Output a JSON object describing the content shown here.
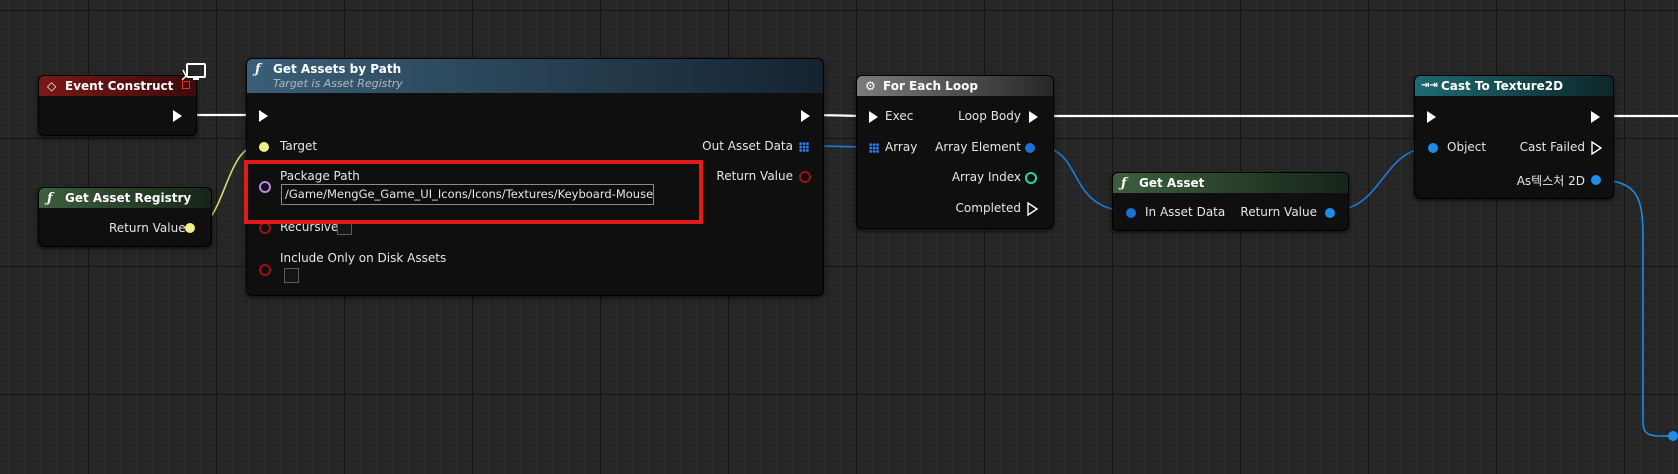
{
  "nodes": {
    "event_construct": {
      "title": "Event Construct"
    },
    "get_asset_registry": {
      "title": "Get Asset Registry",
      "return_value": "Return Value"
    },
    "get_assets_by_path": {
      "title": "Get Assets by Path",
      "subtitle": "Target is Asset Registry",
      "target": "Target",
      "package_path": "Package Path",
      "package_path_value": "/Game/MengGe_Game_UI_Icons/Icons/Textures/Keyboard-Mouse_",
      "recursive": "Recursive",
      "include_only_on_disk": "Include Only on Disk Assets",
      "out_asset_data": "Out Asset Data",
      "return_value": "Return Value"
    },
    "for_each_loop": {
      "title": "For Each Loop",
      "exec": "Exec",
      "array": "Array",
      "loop_body": "Loop Body",
      "array_element": "Array Element",
      "array_index": "Array Index",
      "completed": "Completed"
    },
    "get_asset": {
      "title": "Get Asset",
      "in_asset_data": "In Asset Data",
      "return_value": "Return Value"
    },
    "cast_to_texture2d": {
      "title": "Cast To Texture2D",
      "object": "Object",
      "cast_failed": "Cast Failed",
      "as_texture2d": "As텍스처 2D"
    }
  },
  "colors": {
    "exec_wire": "#ffffff",
    "object_wire": "#0d6fd1",
    "registry_wire": "#d8d870",
    "highlight": "#e21a1a"
  }
}
